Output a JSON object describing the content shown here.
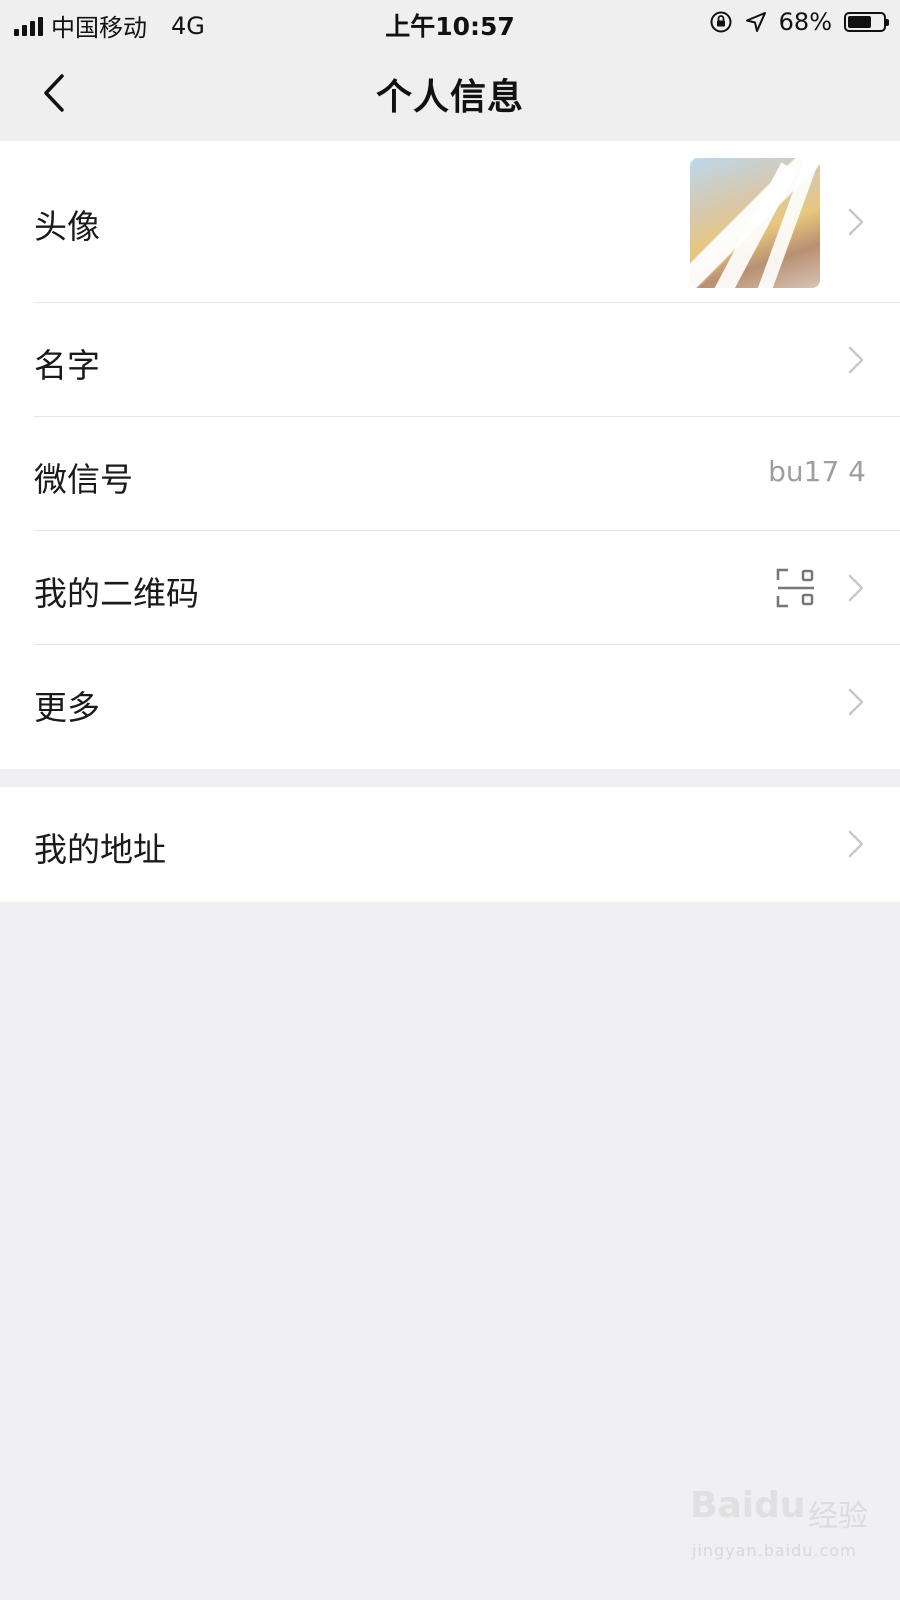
{
  "status_bar": {
    "carrier": "中国移动",
    "network": "4G",
    "time": "上午10:57",
    "battery_percent_label": "68%",
    "battery_level": 0.68
  },
  "nav": {
    "title": "个人信息"
  },
  "rows": {
    "avatar": {
      "label": "头像"
    },
    "name": {
      "label": "名字",
      "value": ""
    },
    "wechat_id": {
      "label": "微信号",
      "value": "bu17 4"
    },
    "qr_code": {
      "label": "我的二维码"
    },
    "more": {
      "label": "更多"
    },
    "address": {
      "label": "我的地址"
    }
  },
  "watermark": {
    "logo": "Baidu",
    "text": "经验",
    "url": "jingyan.baidu.com"
  },
  "colors": {
    "background": "#efeff4",
    "row_background": "#ffffff",
    "secondary_text": "#b9b9b9"
  }
}
